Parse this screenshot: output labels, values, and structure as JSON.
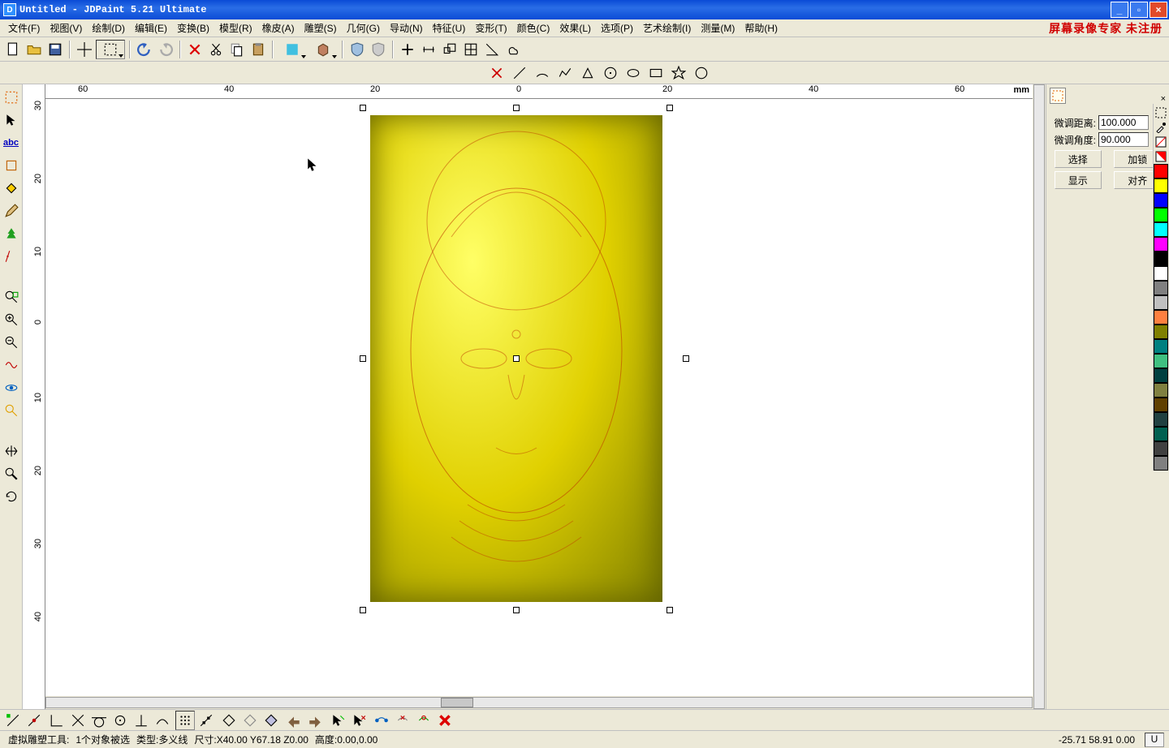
{
  "title": "Untitled - JDPaint 5.21 Ultimate",
  "watermark": "屏幕录像专家 未注册",
  "menu": [
    "文件(F)",
    "视图(V)",
    "绘制(D)",
    "编辑(E)",
    "变换(B)",
    "模型(R)",
    "橡皮(A)",
    "雕塑(S)",
    "几何(G)",
    "导动(N)",
    "特征(U)",
    "变形(T)",
    "颜色(C)",
    "效果(L)",
    "选项(P)",
    "艺术绘制(I)",
    "测量(M)",
    "帮助(H)"
  ],
  "ruler": {
    "unit": "mm",
    "h_labels": [
      "60",
      "40",
      "20",
      "0",
      "20",
      "40",
      "60"
    ],
    "v_labels": [
      "30",
      "20",
      "10",
      "0",
      "10",
      "20",
      "30",
      "40"
    ]
  },
  "panel": {
    "dist_label": "微调距离:",
    "dist_value": "100.000",
    "angle_label": "微调角度:",
    "angle_value": "90.000",
    "btn_select": "选择",
    "btn_lock": "加锁",
    "btn_show": "显示",
    "btn_align": "对齐"
  },
  "colors": [
    "#ff0000",
    "#ffff00",
    "#0000ff",
    "#00ff00",
    "#00ffff",
    "#ff00ff",
    "#000000",
    "#ffffff",
    "#808080",
    "#c0c0c0",
    "#ff8040",
    "#808000",
    "#008080",
    "#40c080",
    "#004040",
    "#808040",
    "#604000",
    "#204040",
    "#006050",
    "#404040",
    "#808080"
  ],
  "status": {
    "tool": "虚拟雕塑工具:",
    "sel": "1个对象被选",
    "type": "类型:多义线",
    "size": "尺寸:X40.00 Y67.18 Z0.00",
    "height": "高度:0.00,0.00",
    "coords": "-25.71 58.91 0.00",
    "u": "U"
  }
}
